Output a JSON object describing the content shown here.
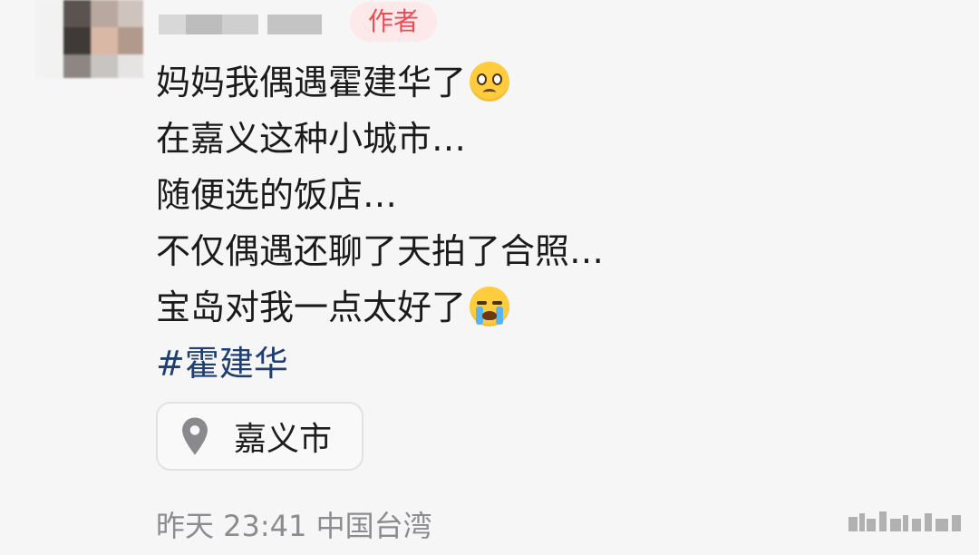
{
  "author": {
    "badge": "作者"
  },
  "post": {
    "lines": [
      "妈妈我偶遇霍建华了",
      "在嘉义这种小城市…",
      "随便选的饭店…",
      "不仅偶遇还聊了天拍了合照…",
      "宝岛对我一点太好了"
    ],
    "emojis": [
      "pleading-face-icon",
      "loudly-crying-face-icon"
    ],
    "hashtag": "#霍建华"
  },
  "location": {
    "label": "嘉义市",
    "icon": "location-pin-icon"
  },
  "meta": {
    "timestamp": "昨天 23:41 中国台湾"
  },
  "colors": {
    "badge_bg": "#fde9ea",
    "badge_text": "#f04a55",
    "hashtag": "#1f3f73",
    "meta_text": "#8c8c90"
  }
}
